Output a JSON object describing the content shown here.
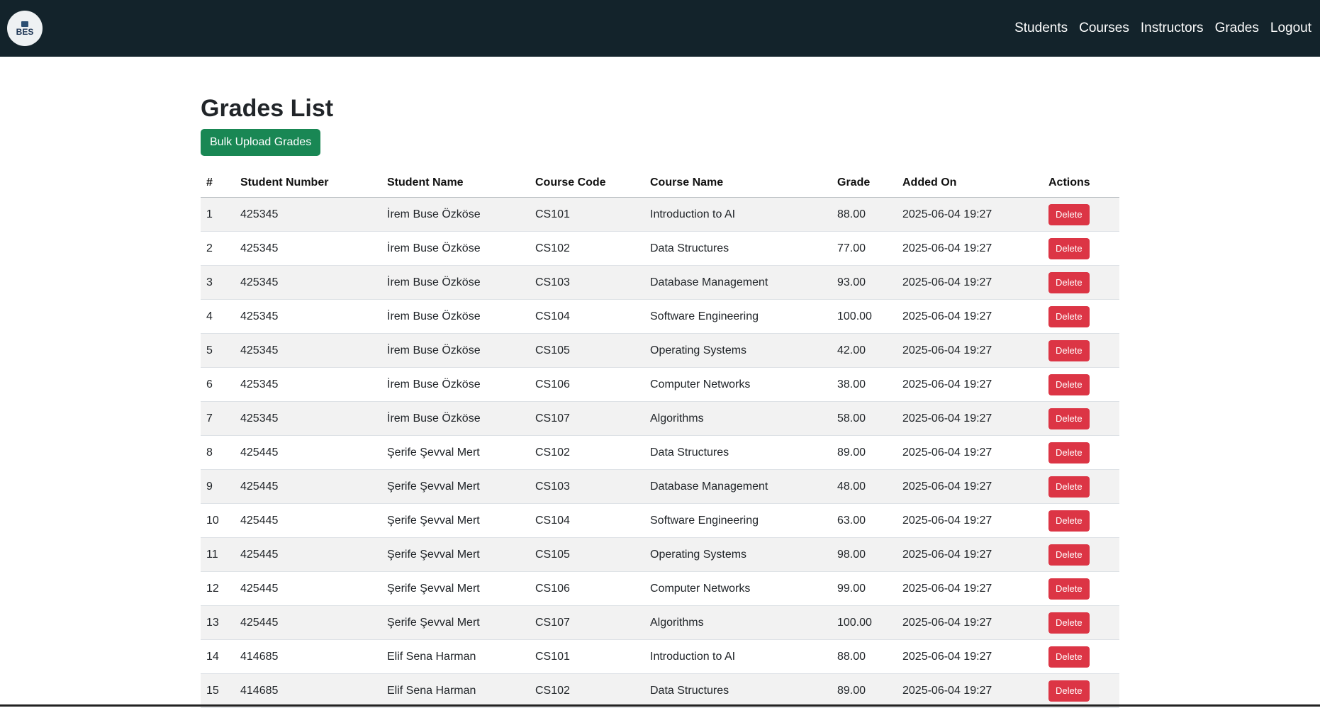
{
  "nav": {
    "logo_text": "BES",
    "links": [
      "Students",
      "Courses",
      "Instructors",
      "Grades",
      "Logout"
    ]
  },
  "page": {
    "title": "Grades List",
    "bulk_upload_label": "Bulk Upload Grades"
  },
  "table": {
    "headers": [
      "#",
      "Student Number",
      "Student Name",
      "Course Code",
      "Course Name",
      "Grade",
      "Added On",
      "Actions"
    ],
    "delete_label": "Delete",
    "rows": [
      [
        "1",
        "425345",
        "İrem Buse Özköse",
        "CS101",
        "Introduction to AI",
        "88.00",
        "2025-06-04 19:27"
      ],
      [
        "2",
        "425345",
        "İrem Buse Özköse",
        "CS102",
        "Data Structures",
        "77.00",
        "2025-06-04 19:27"
      ],
      [
        "3",
        "425345",
        "İrem Buse Özköse",
        "CS103",
        "Database Management",
        "93.00",
        "2025-06-04 19:27"
      ],
      [
        "4",
        "425345",
        "İrem Buse Özköse",
        "CS104",
        "Software Engineering",
        "100.00",
        "2025-06-04 19:27"
      ],
      [
        "5",
        "425345",
        "İrem Buse Özköse",
        "CS105",
        "Operating Systems",
        "42.00",
        "2025-06-04 19:27"
      ],
      [
        "6",
        "425345",
        "İrem Buse Özköse",
        "CS106",
        "Computer Networks",
        "38.00",
        "2025-06-04 19:27"
      ],
      [
        "7",
        "425345",
        "İrem Buse Özköse",
        "CS107",
        "Algorithms",
        "58.00",
        "2025-06-04 19:27"
      ],
      [
        "8",
        "425445",
        "Şerife Şevval Mert",
        "CS102",
        "Data Structures",
        "89.00",
        "2025-06-04 19:27"
      ],
      [
        "9",
        "425445",
        "Şerife Şevval Mert",
        "CS103",
        "Database Management",
        "48.00",
        "2025-06-04 19:27"
      ],
      [
        "10",
        "425445",
        "Şerife Şevval Mert",
        "CS104",
        "Software Engineering",
        "63.00",
        "2025-06-04 19:27"
      ],
      [
        "11",
        "425445",
        "Şerife Şevval Mert",
        "CS105",
        "Operating Systems",
        "98.00",
        "2025-06-04 19:27"
      ],
      [
        "12",
        "425445",
        "Şerife Şevval Mert",
        "CS106",
        "Computer Networks",
        "99.00",
        "2025-06-04 19:27"
      ],
      [
        "13",
        "425445",
        "Şerife Şevval Mert",
        "CS107",
        "Algorithms",
        "100.00",
        "2025-06-04 19:27"
      ],
      [
        "14",
        "414685",
        "Elif Sena Harman",
        "CS101",
        "Introduction to AI",
        "88.00",
        "2025-06-04 19:27"
      ],
      [
        "15",
        "414685",
        "Elif Sena Harman",
        "CS102",
        "Data Structures",
        "89.00",
        "2025-06-04 19:27"
      ]
    ]
  },
  "colors": {
    "navbar_bg": "#13232b",
    "success": "#198754",
    "danger": "#dc3545"
  }
}
